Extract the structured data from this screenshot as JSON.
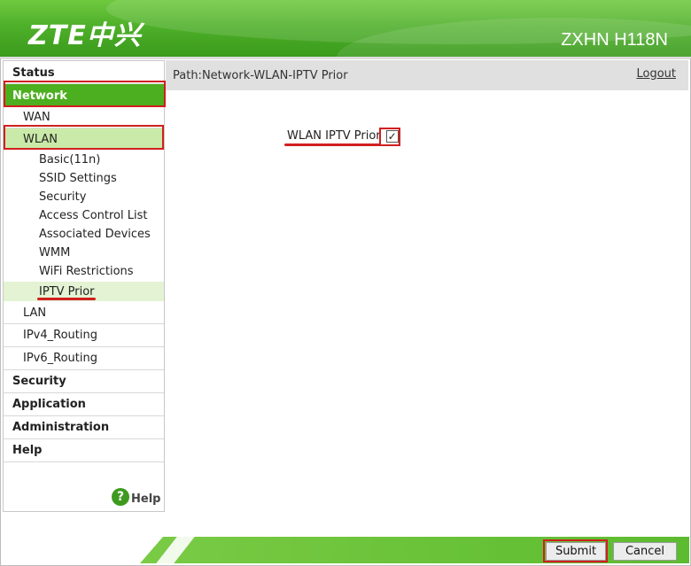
{
  "header": {
    "logo_text": "ZTE中兴",
    "model": "ZXHN H118N"
  },
  "sidebar": {
    "items": [
      {
        "label": "Status",
        "level": "top"
      },
      {
        "label": "Network",
        "level": "top",
        "state": "expanded-selected"
      },
      {
        "label": "WAN",
        "level": "sub"
      },
      {
        "label": "WLAN",
        "level": "sub",
        "state": "expanded-selected"
      },
      {
        "label": "Basic(11n)",
        "level": "leaf"
      },
      {
        "label": "SSID Settings",
        "level": "leaf"
      },
      {
        "label": "Security",
        "level": "leaf"
      },
      {
        "label": "Access Control List",
        "level": "leaf"
      },
      {
        "label": "Associated Devices",
        "level": "leaf"
      },
      {
        "label": "WMM",
        "level": "leaf"
      },
      {
        "label": "WiFi Restrictions",
        "level": "leaf"
      },
      {
        "label": "IPTV Prior",
        "level": "leaf",
        "state": "current"
      },
      {
        "label": "LAN",
        "level": "sub"
      },
      {
        "label": "IPv4_Routing",
        "level": "sub"
      },
      {
        "label": "IPv6_Routing",
        "level": "sub"
      },
      {
        "label": "Security",
        "level": "top"
      },
      {
        "label": "Application",
        "level": "top"
      },
      {
        "label": "Administration",
        "level": "top"
      },
      {
        "label": "Help",
        "level": "top"
      }
    ],
    "help_label": "Help",
    "help_icon": "?"
  },
  "pathbar": {
    "path": "Path:Network-WLAN-IPTV Prior",
    "logout_label": "Logout"
  },
  "content": {
    "option_label": "WLAN IPTV Prior",
    "option_checked": true,
    "check_glyph": "✓"
  },
  "footer": {
    "submit_label": "Submit",
    "cancel_label": "Cancel"
  },
  "colors": {
    "brand_green": "#4caf1f",
    "highlight_red": "#d11f1f"
  }
}
